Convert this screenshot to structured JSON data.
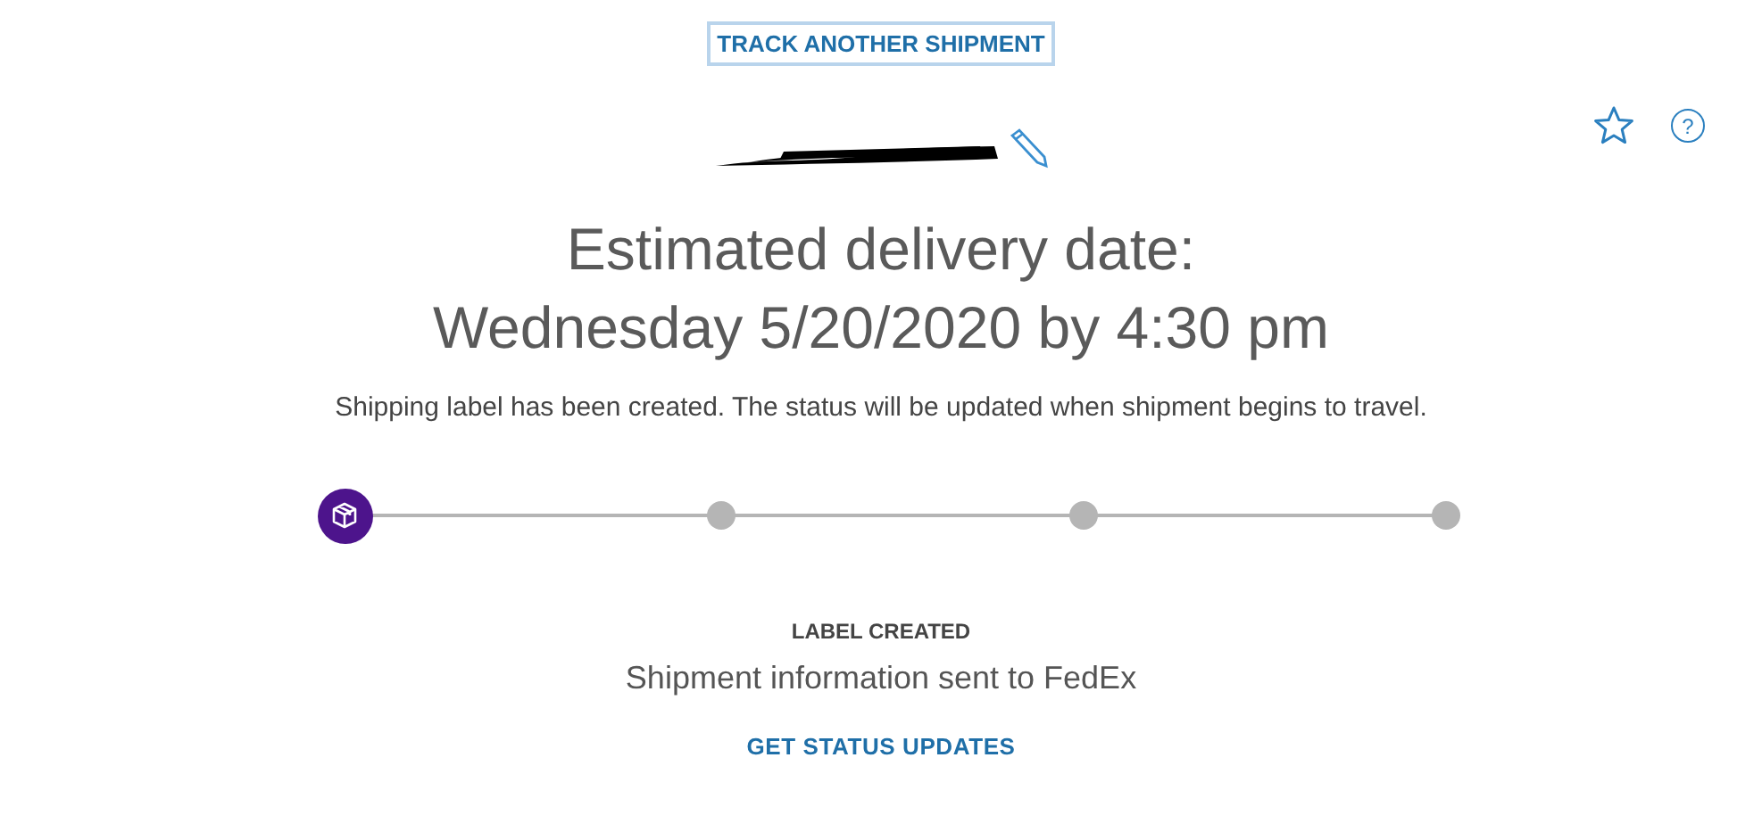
{
  "track_button": {
    "label": "TRACK ANOTHER SHIPMENT"
  },
  "actions": {
    "help_glyph": "?"
  },
  "heading": {
    "line_1": "Estimated delivery date:",
    "line_2": "Wednesday 5/20/2020 by 4:30 pm"
  },
  "message": "Shipping label has been created. The status will be updated when shipment begins to travel.",
  "steps": [
    {
      "selected": true
    },
    {
      "selected": false
    },
    {
      "selected": false
    },
    {
      "selected": false
    }
  ],
  "status": {
    "title": "LABEL CREATED",
    "detail": "Shipment information sent to FedEx"
  },
  "updates_link": {
    "label": "GET STATUS UPDATES"
  }
}
